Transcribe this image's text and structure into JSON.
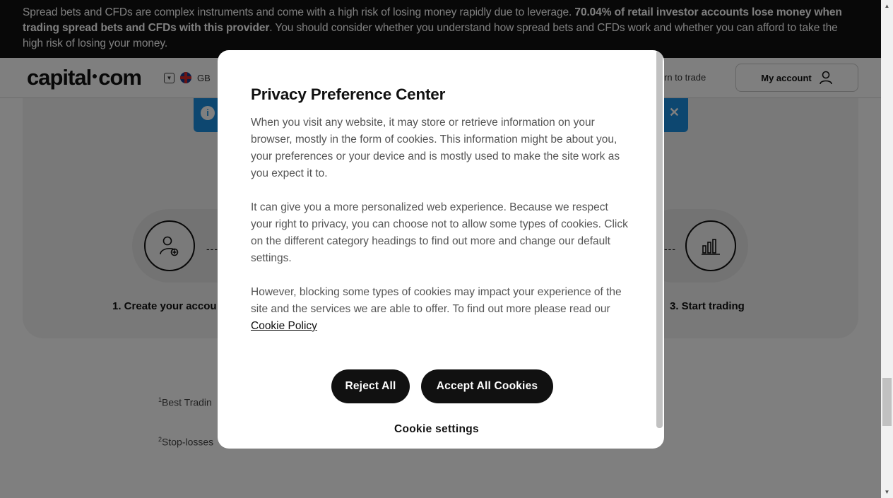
{
  "risk_banner": {
    "text_1": "Spread bets and CFDs are complex instruments and come with a high risk of losing money rapidly due to leverage. ",
    "text_bold": "70.04% of retail investor accounts lose money when trading spread bets and CFDs with this provider",
    "text_2": ". You should consider whether you understand how spread bets and CFDs work and whether you can afford to take the high risk of losing your money."
  },
  "header": {
    "logo_left": "capital",
    "logo_right": "com",
    "region_code": "GB",
    "learn_link": "rn to trade",
    "account_label": "My account"
  },
  "steps": [
    {
      "label": "1. Create your accou",
      "icon": "user-plus-icon"
    },
    {
      "label": "3. Start trading",
      "icon": "bar-chart-icon"
    }
  ],
  "footnotes": [
    {
      "num": "1",
      "text": "Best Tradin"
    },
    {
      "num": "2",
      "text": "Stop-losses"
    }
  ],
  "modal": {
    "title": "Privacy Preference Center",
    "para_1": "When you visit any website, it may store or retrieve information on your browser, mostly in the form of cookies. This information might be about you, your preferences or your device and is mostly used to make the site work as you expect it to.",
    "para_2": "It can give you a more personalized web experience. Because we respect your right to privacy, you can choose not to allow some types of cookies. Click on the different category headings to find out more and change our default settings.",
    "para_3": "However, blocking some types of cookies may impact your experience of the site and the services we are able to offer. To find out more please read our ",
    "cookie_policy_link": "Cookie Policy",
    "reject_label": "Reject All",
    "accept_label": "Accept All Cookies",
    "settings_label": "Cookie settings"
  },
  "colors": {
    "banner_bg": "#111111",
    "info_bar": "#1a8fe0",
    "button_bg": "#111111"
  }
}
